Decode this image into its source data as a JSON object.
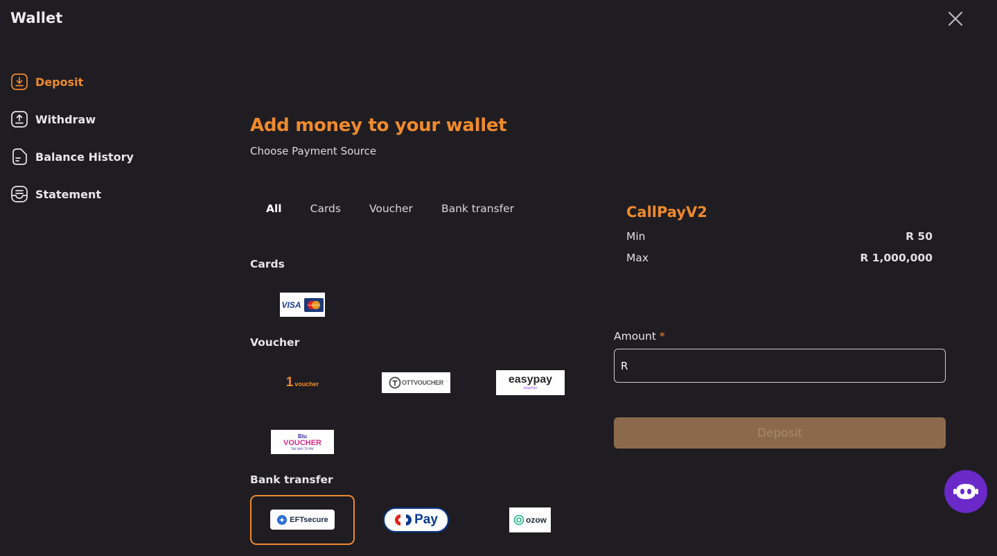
{
  "window": {
    "title": "Wallet"
  },
  "sidebar": {
    "items": [
      {
        "label": "Deposit",
        "icon": "deposit-icon",
        "active": true
      },
      {
        "label": "Withdraw",
        "icon": "withdraw-icon",
        "active": false
      },
      {
        "label": "Balance History",
        "icon": "document-icon",
        "active": false
      },
      {
        "label": "Statement",
        "icon": "statement-icon",
        "active": false
      }
    ]
  },
  "main": {
    "heading": "Add money to your wallet",
    "subheading": "Choose Payment Source",
    "tabs": [
      {
        "label": "All",
        "active": true
      },
      {
        "label": "Cards",
        "active": false
      },
      {
        "label": "Voucher",
        "active": false
      },
      {
        "label": "Bank transfer",
        "active": false
      }
    ],
    "sections": {
      "cards": {
        "label": "Cards",
        "methods": [
          "VISA / Mastercard"
        ]
      },
      "voucher": {
        "label": "Voucher",
        "methods": [
          "1voucher",
          "OTT VOUCHER",
          "easypay voucher",
          "Blu VOUCHER"
        ]
      },
      "bank_transfer": {
        "label": "Bank transfer",
        "methods": [
          "EFTsecure",
          "Capitec Pay",
          "ozow"
        ]
      }
    },
    "logo_text": {
      "visa": "VISA",
      "mastercard": "mastercard",
      "onevoucher_num": "1",
      "onevoucher": "voucher",
      "ott": "OTTVOUCHER",
      "easypay": "easypay",
      "easypay_sub": "voucher",
      "blu_top": "Blu",
      "blu_main": "VOUCHER",
      "blu_tag": "THE WAY TO PAY",
      "eft": "EFTsecure",
      "capitec": "Pay",
      "ozow": "ozow"
    }
  },
  "provider": {
    "name": "CallPayV2",
    "min_label": "Min",
    "min_value": "R 50",
    "max_label": "Max",
    "max_value": "R 1,000,000"
  },
  "form": {
    "amount_label": "Amount",
    "required_mark": "*",
    "currency_prefix": "R",
    "amount_value": "",
    "deposit_label": "Deposit"
  },
  "colors": {
    "background": "#1f1d22",
    "accent": "#f08a2c",
    "deposit_button": "#8b6a4c",
    "chat_button": "#6a29c8"
  }
}
